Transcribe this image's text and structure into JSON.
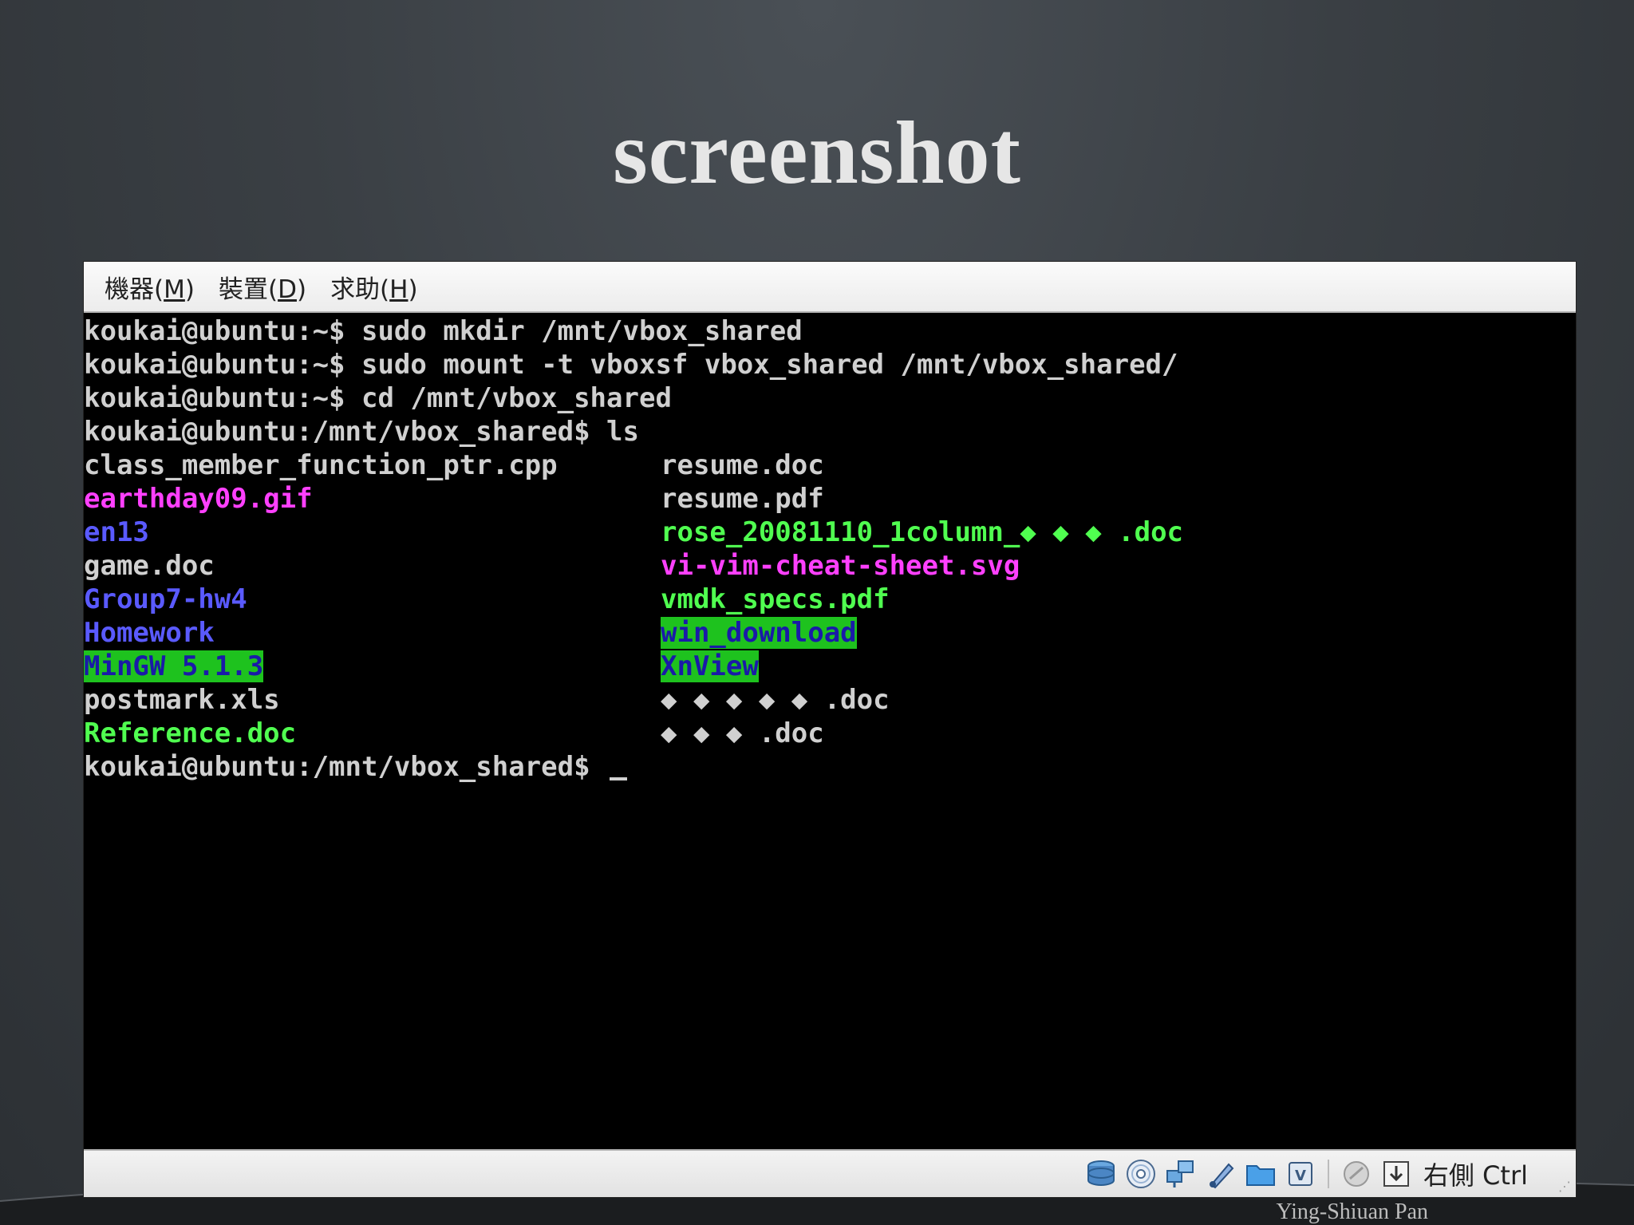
{
  "slide": {
    "title": "screenshot",
    "author": "Ying-Shiuan Pan"
  },
  "menubar": {
    "items": [
      {
        "label": "機器(",
        "mnemonic": "M",
        "suffix": ")"
      },
      {
        "label": "裝置(",
        "mnemonic": "D",
        "suffix": ")"
      },
      {
        "label": "求助(",
        "mnemonic": "H",
        "suffix": ")"
      }
    ]
  },
  "terminal": {
    "commands": [
      "koukai@ubuntu:~$ sudo mkdir /mnt/vbox_shared",
      "koukai@ubuntu:~$ sudo mount -t vboxsf vbox_shared /mnt/vbox_shared/",
      "koukai@ubuntu:~$ cd /mnt/vbox_shared",
      "koukai@ubuntu:/mnt/vbox_shared$ ls"
    ],
    "listing_left": [
      {
        "name": "class_member_function_ptr.cpp",
        "color": "#d0d0d0"
      },
      {
        "name": "earthday09.gif",
        "color": "#ff40ff"
      },
      {
        "name": "en13",
        "color": "#5a5aff"
      },
      {
        "name": "game.doc",
        "color": "#d0d0d0"
      },
      {
        "name": "Group7-hw4",
        "color": "#5a5aff"
      },
      {
        "name": "Homework",
        "color": "#5a5aff"
      },
      {
        "name": "MinGW 5.1.3",
        "color": "#1a1aa8",
        "highlight": "#1ec21e"
      },
      {
        "name": "postmark.xls",
        "color": "#d0d0d0"
      },
      {
        "name": "Reference.doc",
        "color": "#50ff50"
      }
    ],
    "listing_right": [
      {
        "name": "resume.doc",
        "color": "#d0d0d0"
      },
      {
        "name": "resume.pdf",
        "color": "#d0d0d0"
      },
      {
        "name": "rose_20081110_1column_◆ ◆ ◆ .doc",
        "color": "#50ff50"
      },
      {
        "name": "vi-vim-cheat-sheet.svg",
        "color": "#ff40ff"
      },
      {
        "name": "vmdk_specs.pdf",
        "color": "#50ff50"
      },
      {
        "name": "win_download",
        "color": "#1a1aa8",
        "highlight": "#1ec21e"
      },
      {
        "name": "XnView",
        "color": "#1a1aa8",
        "highlight": "#1ec21e"
      },
      {
        "name": "◆ ◆ ◆ ◆ ◆ .doc",
        "color": "#d0d0d0"
      },
      {
        "name": "◆ ◆ ◆ .doc",
        "color": "#d0d0d0"
      }
    ],
    "prompt": "koukai@ubuntu:/mnt/vbox_shared$ "
  },
  "statusbar": {
    "icons": [
      "hard-disk-icon",
      "cd-dvd-icon",
      "network-icon",
      "usb-icon",
      "shared-folder-icon",
      "virtualization-icon",
      "mouse-integration-icon",
      "host-key-arrow-icon"
    ],
    "host_key": "右側 Ctrl"
  }
}
